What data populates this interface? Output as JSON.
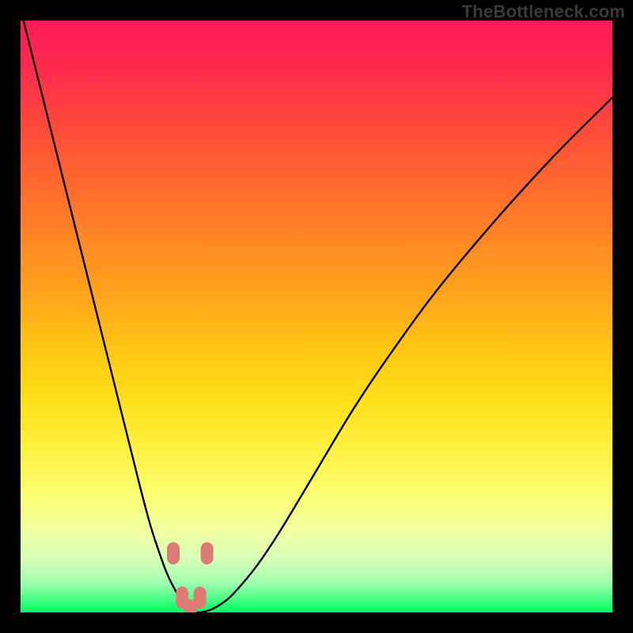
{
  "watermark": "TheBottleneck.com",
  "colors": {
    "frame": "#000000",
    "curve": "#000000",
    "point_fill": "#dd7a73",
    "gradient_stops": [
      "#ff1a58",
      "#ff2a4e",
      "#ff4a3a",
      "#ff6a2e",
      "#ff8a24",
      "#ffaa1a",
      "#ffc814",
      "#ffe018",
      "#fff040",
      "#fbff70",
      "#f2ffa0",
      "#d8ffb8",
      "#a0ffb0",
      "#40ff80",
      "#00ff60"
    ]
  },
  "chart_data": {
    "type": "line",
    "title": "",
    "xlabel": "",
    "ylabel": "",
    "xlim": [
      0,
      100
    ],
    "ylim": [
      0,
      100
    ],
    "grid": false,
    "legend_position": "none",
    "series": [
      {
        "name": "curve",
        "x": [
          0,
          4,
          8,
          12,
          16,
          20,
          22,
          24,
          25,
          26,
          27,
          28,
          29,
          30,
          32,
          34,
          36,
          40,
          44,
          50,
          56,
          62,
          70,
          80,
          90,
          100
        ],
        "values": [
          102,
          86,
          70,
          54,
          38,
          22,
          14.5,
          8.5,
          6,
          4,
          2.3,
          1.2,
          0.4,
          0,
          0.4,
          1.5,
          3.2,
          8,
          14,
          24,
          34,
          43,
          54,
          66,
          77,
          87
        ]
      }
    ],
    "points": [
      {
        "x": 25.8,
        "y": 10.0
      },
      {
        "x": 31.5,
        "y": 10.0
      },
      {
        "x": 27.3,
        "y": 2.5
      },
      {
        "x": 30.3,
        "y": 2.5
      },
      {
        "x": 28.7,
        "y": 0.3
      }
    ]
  }
}
